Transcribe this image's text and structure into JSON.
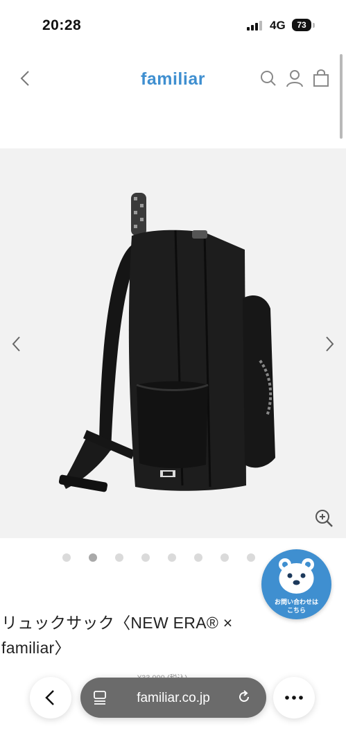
{
  "status_bar": {
    "time": "20:28",
    "network": "4G",
    "battery": "73"
  },
  "header": {
    "logo": "familiar"
  },
  "gallery": {
    "dot_count": 8,
    "active_index": 1
  },
  "contact": {
    "label_line1": "お問い合わせは",
    "label_line2": "こちら"
  },
  "product": {
    "title": "リュックサック〈NEW ERA® × familiar〉",
    "price_peek": "¥33,000 (税込)"
  },
  "browser": {
    "url": "familiar.co.jp"
  }
}
